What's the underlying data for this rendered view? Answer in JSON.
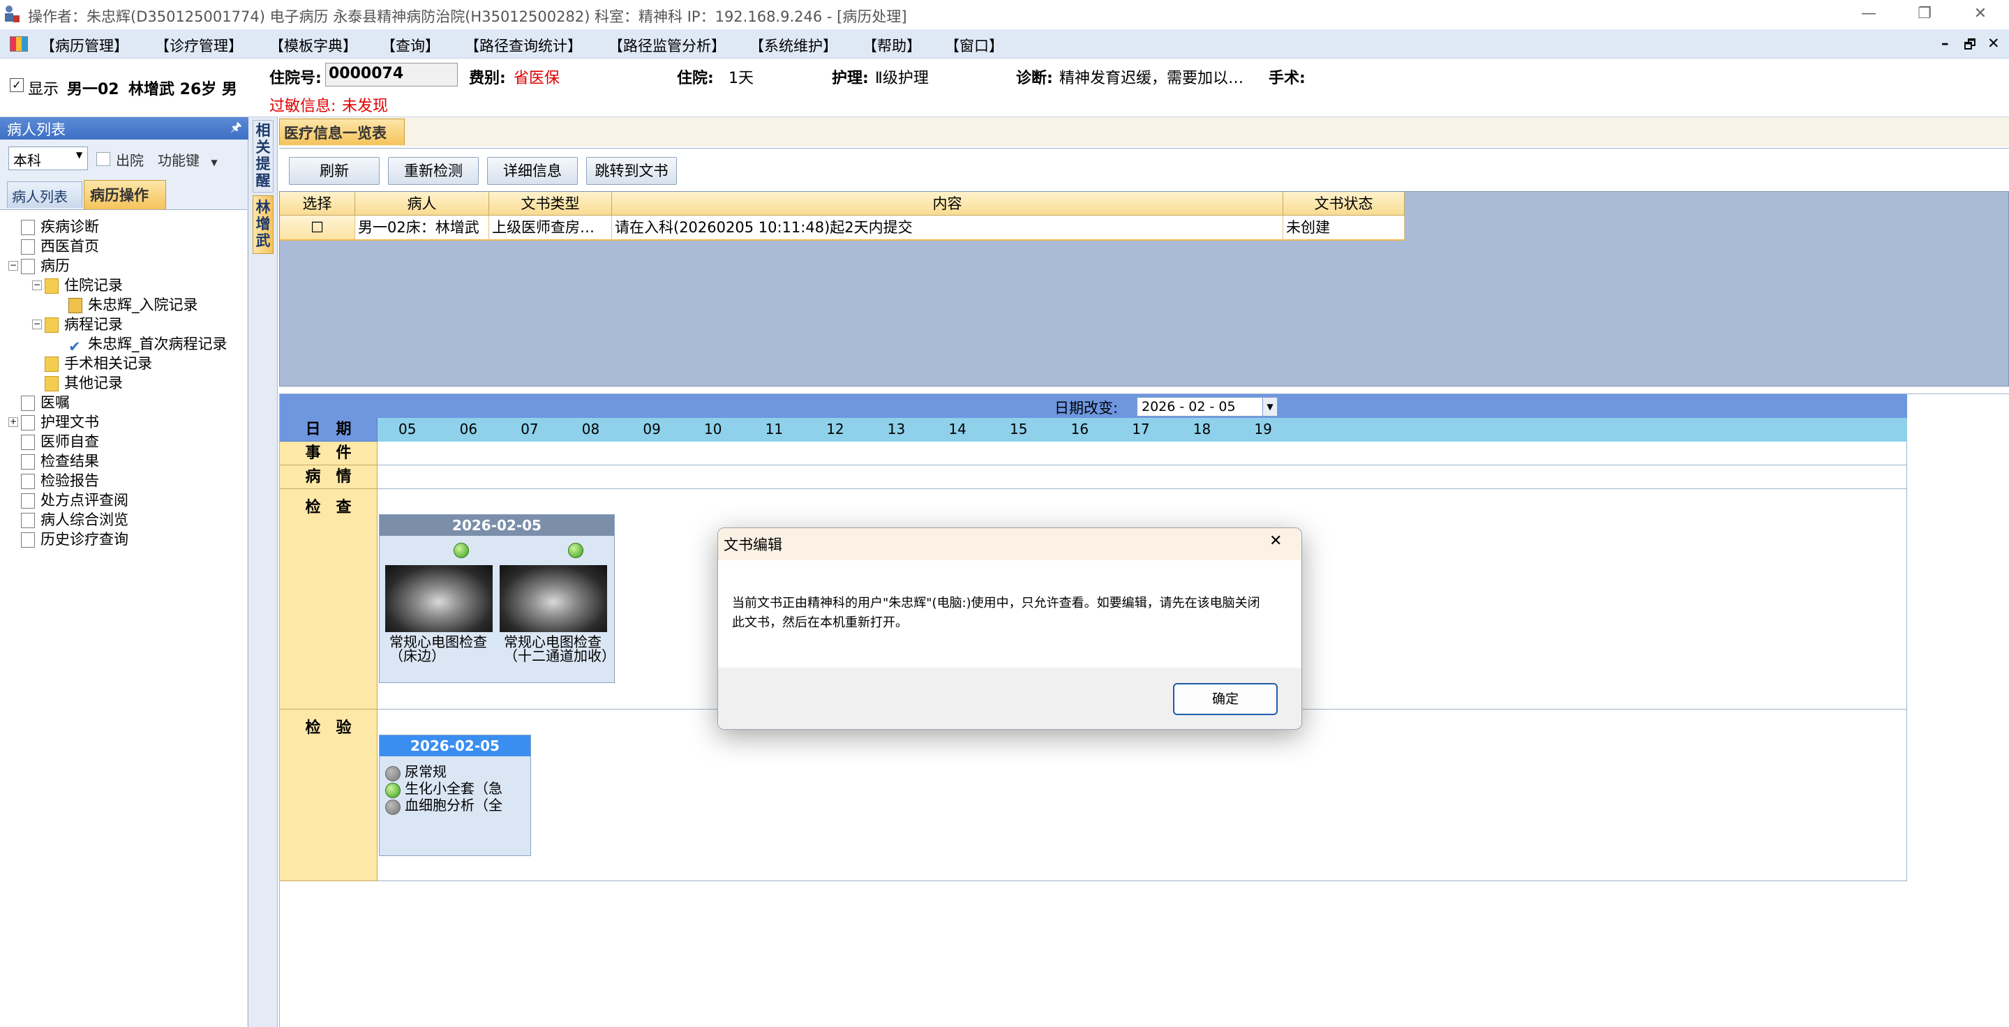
{
  "titlebar": {
    "title": "操作者：朱忠辉(D350125001774) 电子病历 永泰县精神病防治院(H35012500282) 科室：精神科 IP：192.168.9.246 - [病历处理]",
    "minimize": "—",
    "restore": "❐",
    "close": "✕"
  },
  "menu": {
    "items": [
      "【病历管理】",
      "【诊疗管理】",
      "【模板字典】",
      "【查询】",
      "【路径查询统计】",
      "【路径监管分析】",
      "【系统维护】",
      "【帮助】",
      "【窗口】"
    ],
    "mdi_min": "–",
    "mdi_restore": "🗗",
    "mdi_close": "✕"
  },
  "patient": {
    "show_label": "显示",
    "bed": "男一02",
    "name_age": "林增武 26岁 男",
    "admission_no_label": "住院号:",
    "admission_no": "0000074",
    "category_label": "费别:",
    "category": "省医保",
    "stay_label": "住院:",
    "stay": "1天",
    "nursing_label": "护理:",
    "nursing": "Ⅱ级护理",
    "diagnosis_label": "诊断:",
    "diagnosis": "精神发育迟缓，需要加以…",
    "surgery_label": "手术:",
    "allergy_label": "过敏信息:",
    "allergy": "未发现"
  },
  "leftpanel": {
    "title": "病人列表",
    "pin": "🖈",
    "dept": "本科",
    "discharged": "出院",
    "func": "功能键",
    "tabs": [
      "病人列表",
      "病历操作"
    ],
    "tree": [
      {
        "label": "疾病诊断",
        "lvl": 0,
        "icon": "doc"
      },
      {
        "label": "西医首页",
        "lvl": 0,
        "icon": "doc"
      },
      {
        "label": "病历",
        "lvl": 0,
        "icon": "doc",
        "exp": "−"
      },
      {
        "label": "住院记录",
        "lvl": 1,
        "icon": "fold",
        "exp": "−"
      },
      {
        "label": "朱忠辉_入院记录",
        "lvl": 2,
        "icon": "lock"
      },
      {
        "label": "病程记录",
        "lvl": 1,
        "icon": "fold",
        "exp": "−"
      },
      {
        "label": "朱忠辉_首次病程记录",
        "lvl": 2,
        "icon": "check"
      },
      {
        "label": "手术相关记录",
        "lvl": 1,
        "icon": "fold"
      },
      {
        "label": "其他记录",
        "lvl": 1,
        "icon": "fold"
      },
      {
        "label": "医嘱",
        "lvl": 0,
        "icon": "doc"
      },
      {
        "label": "护理文书",
        "lvl": 0,
        "icon": "doc",
        "exp": "+"
      },
      {
        "label": "医师自查",
        "lvl": 0,
        "icon": "doc"
      },
      {
        "label": "检查结果",
        "lvl": 0,
        "icon": "doc"
      },
      {
        "label": "检验报告",
        "lvl": 0,
        "icon": "doc"
      },
      {
        "label": "处方点评查阅",
        "lvl": 0,
        "icon": "doc"
      },
      {
        "label": "病人综合浏览",
        "lvl": 0,
        "icon": "doc"
      },
      {
        "label": "历史诊疗查询",
        "lvl": 0,
        "icon": "doc"
      }
    ]
  },
  "vstrip": {
    "tab1": "相关提醒",
    "tab2": "林增武"
  },
  "main": {
    "tab": "医疗信息一览表",
    "buttons": [
      "刷新",
      "重新检测",
      "详细信息",
      "跳转到文书"
    ],
    "columns": [
      "选择",
      "病人",
      "文书类型",
      "内容",
      "文书状态"
    ],
    "rows": [
      {
        "select": "☐",
        "patient": "男一02床：林增武",
        "type": "上级医师查房…",
        "content": "请在入科(20260205 10:11:48)起2天内提交",
        "status": "未创建"
      }
    ]
  },
  "timeline": {
    "date_change_label": "日期改变:",
    "date_value": "2026 - 02 - 05",
    "date_header": "日　期",
    "hours": [
      "05",
      "06",
      "07",
      "08",
      "09",
      "10",
      "11",
      "12",
      "13",
      "14",
      "15",
      "16",
      "17",
      "18",
      "19"
    ],
    "row_event": "事　件",
    "row_condition": "病　情",
    "row_exam": "检　查",
    "row_lab": "检　验",
    "exam_card": {
      "date": "2026-02-05",
      "items": [
        "常规心电图检查（床边）",
        "常规心电图检查（十二通道加收）"
      ]
    },
    "lab_card": {
      "date": "2026-02-05",
      "items": [
        "尿常规",
        "生化小全套（急",
        "血细胞分析（全"
      ]
    }
  },
  "dialog": {
    "title": "文书编辑",
    "message": "当前文书正由精神科的用户\"朱忠辉\"(电脑:)使用中，只允许查看。如要编辑，请先在该电脑关闭此文书，然后在本机重新打开。",
    "ok": "确定",
    "close": "✕"
  }
}
